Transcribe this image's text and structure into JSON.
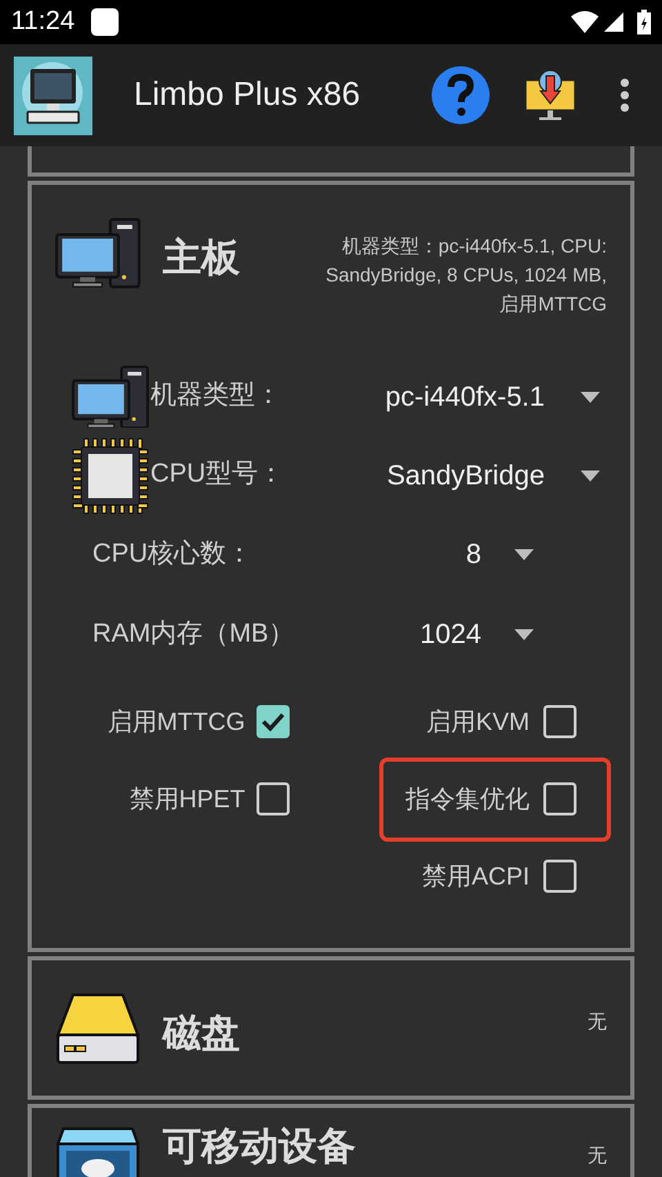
{
  "status_bar": {
    "time": "11:24"
  },
  "app_bar": {
    "title": "Limbo Plus x86"
  },
  "sections": [
    {
      "kind": "motherboard",
      "title": "主板",
      "summary": "机器类型：pc-i440fx-5.1, CPU: SandyBridge, 8 CPUs, 1024 MB, 启用MTTCG",
      "fields": [
        {
          "kind": "machine",
          "label": "机器类型：",
          "value": "pc-i440fx-5.1"
        },
        {
          "kind": "cpu",
          "label": "CPU型号：",
          "value": "SandyBridge"
        },
        {
          "kind": "plain",
          "label": "CPU核心数：",
          "value": "8"
        },
        {
          "kind": "plain",
          "label": "RAM内存（MB）",
          "value": "1024"
        }
      ],
      "option_rows": [
        {
          "left": {
            "label": "启用MTTCG",
            "checked": true,
            "highlighted": false
          },
          "right": {
            "label": "启用KVM",
            "checked": false,
            "highlighted": false
          }
        },
        {
          "left": {
            "label": "禁用HPET",
            "checked": false,
            "highlighted": false
          },
          "right": {
            "label": "指令集优化",
            "checked": false,
            "highlighted": true
          }
        },
        {
          "right": {
            "label": "禁用ACPI",
            "checked": false,
            "highlighted": false
          }
        }
      ]
    },
    {
      "kind": "disk",
      "title": "磁盘",
      "summary": "无"
    },
    {
      "kind": "removable",
      "title": "可移动设备",
      "summary": "无"
    }
  ]
}
